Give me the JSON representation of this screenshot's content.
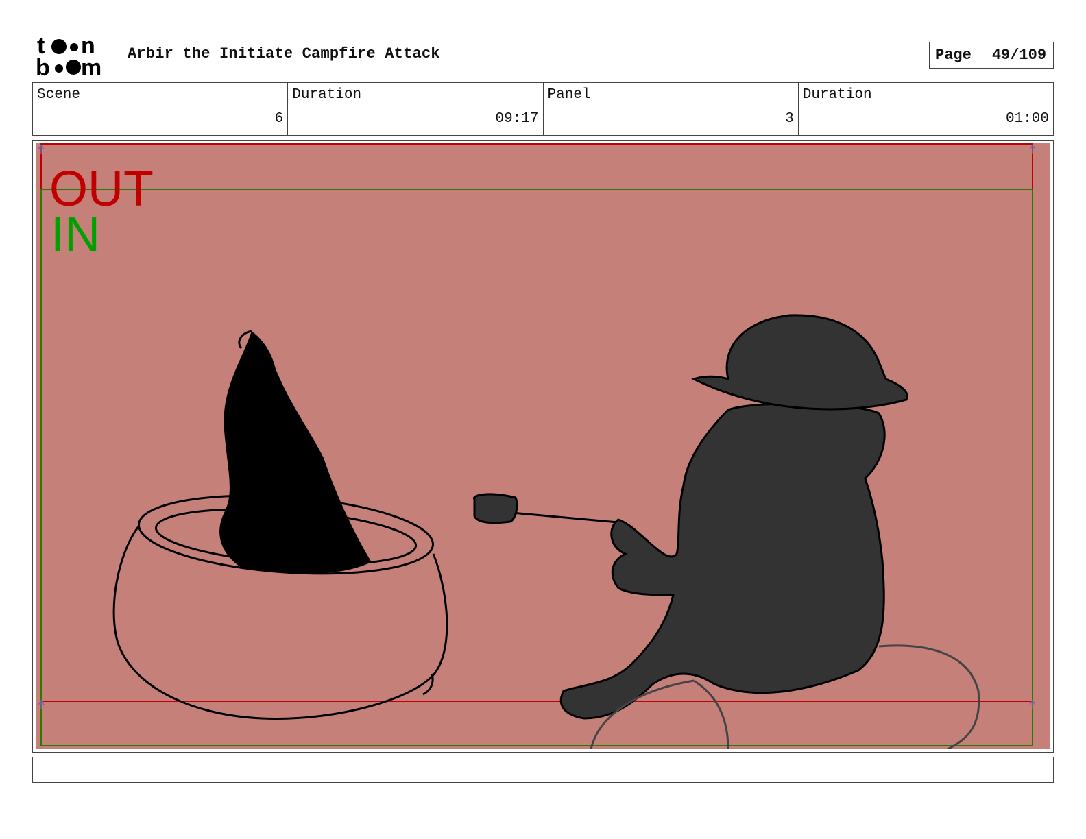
{
  "header": {
    "logo_text": "toon boom",
    "title": "Arbir the Initiate Campfire Attack",
    "page_label": "Page",
    "page_value": "49/109"
  },
  "info": {
    "scene_label": "Scene",
    "scene_value": "6",
    "scene_duration_label": "Duration",
    "scene_duration_value": "09:17",
    "panel_label": "Panel",
    "panel_value": "3",
    "panel_duration_label": "Duration",
    "panel_duration_value": "01:00"
  },
  "frame": {
    "out_label": "OUT",
    "in_label": "IN",
    "background_color": "#c5807a",
    "out_color": "#c00000",
    "in_color": "#00a000"
  },
  "caption": {
    "text": ""
  }
}
